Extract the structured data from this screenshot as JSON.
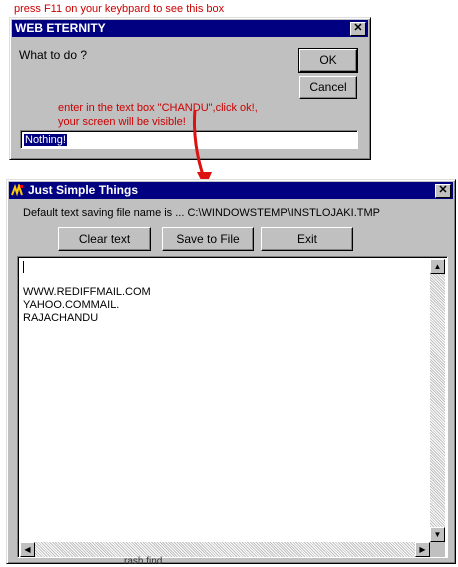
{
  "annotations": {
    "top_note": "press F11 on your keybpard to see this box",
    "instruction_line1": "enter in the text box \"CHANDU\",click ok!,",
    "instruction_line2": "your screen will be  visible!",
    "bottom_fragment": "rash find"
  },
  "dialog": {
    "title": "WEB ETERNITY",
    "prompt": "What to do ?",
    "ok_label": "OK",
    "cancel_label": "Cancel",
    "input_value": "Nothing!",
    "close_glyph": "✕"
  },
  "app": {
    "title": "Just Simple Things",
    "close_glyph": "✕",
    "info_text": "Default text saving file name is ... C:\\WINDOWSTEMP\\INSTLOJAKI.TMP",
    "buttons": {
      "clear": "Clear text",
      "save": "Save to File",
      "exit": "Exit"
    },
    "text_lines": [
      "",
      "",
      "WWW.REDIFFMAIL.COM",
      "YAHOO.COMMAIL.",
      "RAJACHANDU"
    ]
  },
  "colors": {
    "title_bar": "#000080",
    "window_face": "#c0c0c0",
    "annotation_red": "#cc0000"
  },
  "icons": [
    "close-icon",
    "app-icon",
    "scroll-up-icon",
    "scroll-down-icon",
    "scroll-left-icon",
    "scroll-right-icon",
    "arrow-annotation"
  ]
}
